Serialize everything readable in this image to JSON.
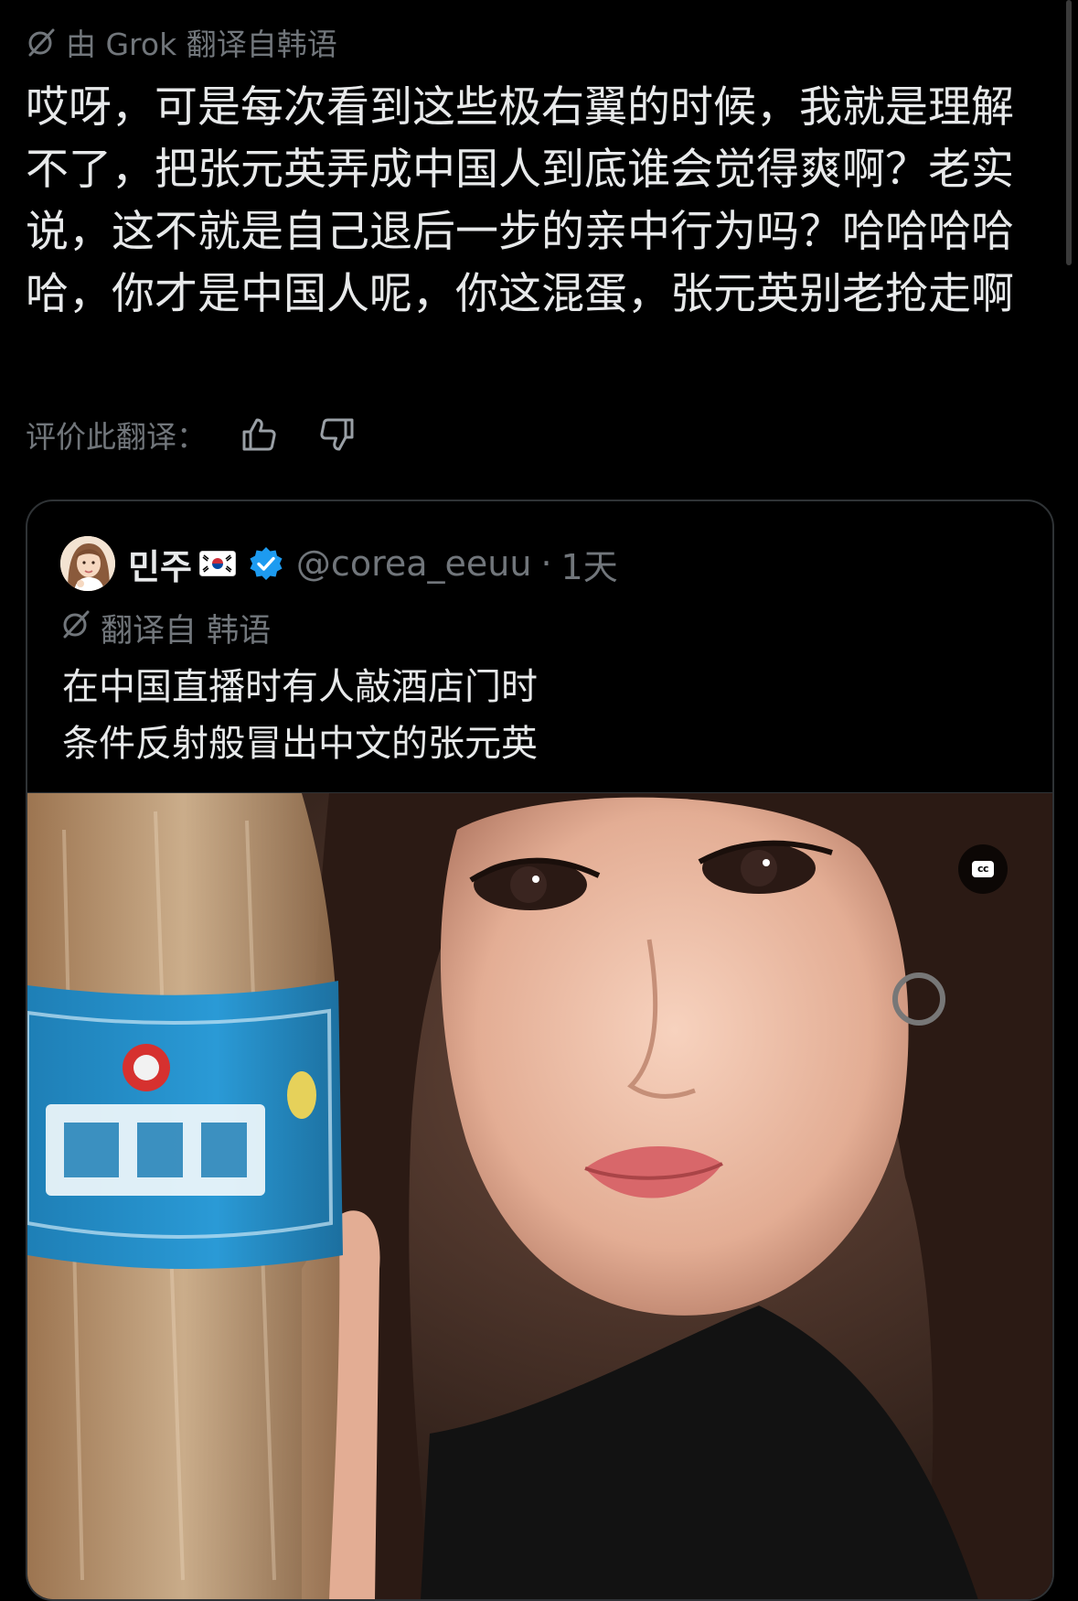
{
  "translation": {
    "source_label": "由 Grok 翻译自韩语",
    "text": "哎呀，可是每次看到这些极右翼的时候，我就是理解不了，把张元英弄成中国人到底谁会觉得爽啊？老实说，这不就是自己退后一步的亲中行为吗？哈哈哈哈哈，你才是中国人呢，你这混蛋，张元英别老抢走啊",
    "rate_label": "评价此翻译：",
    "icons": {
      "source": "grok-icon",
      "thumbs_up": "thumbs-up-icon",
      "thumbs_down": "thumbs-down-icon"
    }
  },
  "quote": {
    "display_name": "민주",
    "flag": "korea-flag-icon",
    "verified": true,
    "handle": "@corea_eeuu",
    "separator": "·",
    "time": "1天",
    "translate_label": "翻译自 韩语",
    "text": "在中国直播时有人敲酒店门时\n条件反射般冒出中文的张元英",
    "media": {
      "type": "video",
      "cc_label": "cc"
    }
  },
  "colors": {
    "background": "#000000",
    "primary_text": "#e7e9ea",
    "secondary_text": "#71767b",
    "border": "#2f3336",
    "verified_blue": "#1d9bf0"
  }
}
